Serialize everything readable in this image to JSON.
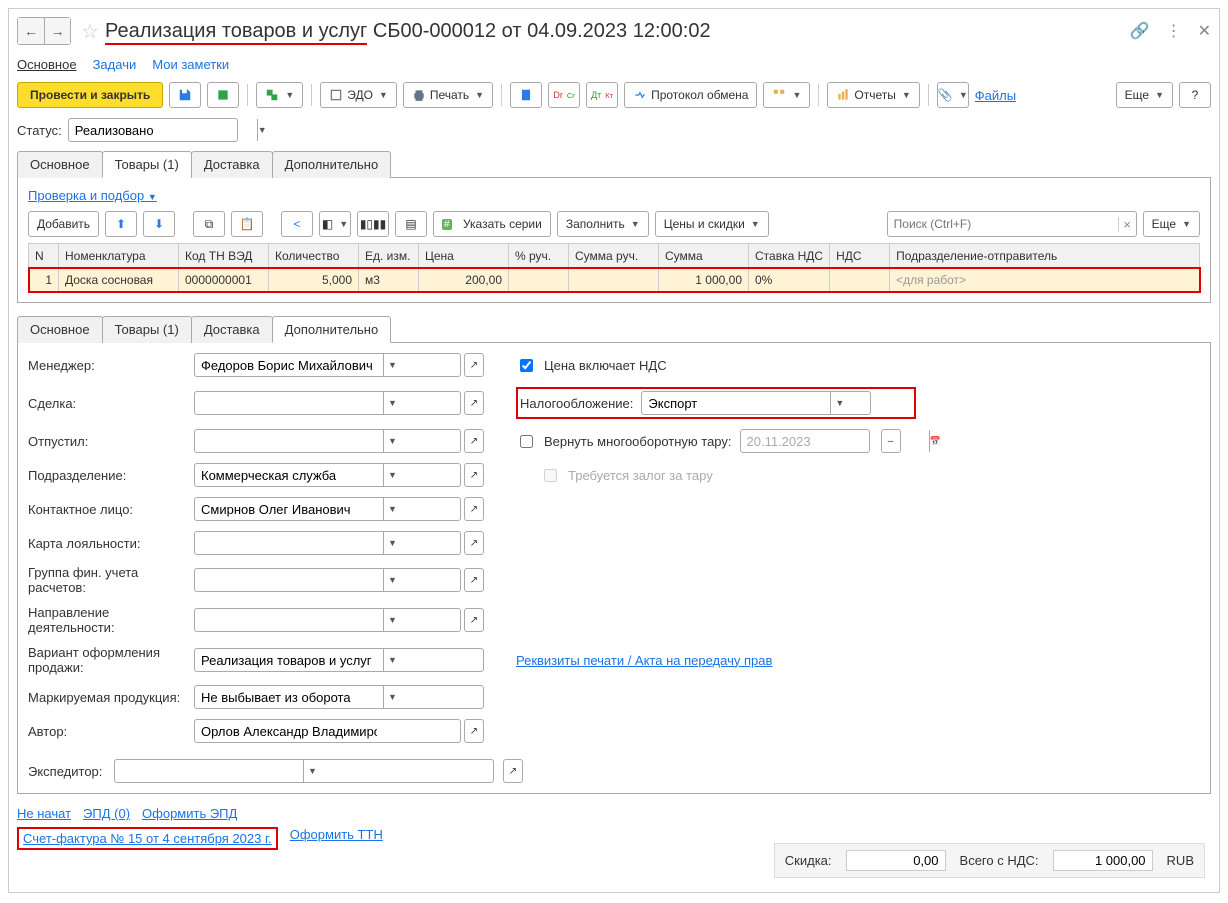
{
  "title": {
    "underlined": "Реализация товаров и услуг",
    "rest": " СБ00-000012 от 04.09.2023 12:00:02"
  },
  "topnav": {
    "main": "Основное",
    "tasks": "Задачи",
    "notes": "Мои заметки"
  },
  "toolbar": {
    "post_close": "Провести и закрыть",
    "edo": "ЭДО",
    "print": "Печать",
    "protocol": "Протокол обмена",
    "reports": "Отчеты",
    "files": "Файлы",
    "more": "Еще",
    "help": "?"
  },
  "status": {
    "label": "Статус:",
    "value": "Реализовано"
  },
  "tabs1": [
    "Основное",
    "Товары (1)",
    "Доставка",
    "Дополнительно"
  ],
  "goods": {
    "check_select": "Проверка и подбор",
    "add": "Добавить",
    "series": "Указать серии",
    "fill": "Заполнить",
    "prices": "Цены и скидки",
    "search_ph": "Поиск (Ctrl+F)",
    "more": "Еще",
    "headers": [
      "N",
      "Номенклатура",
      "Код ТН ВЭД",
      "Количество",
      "Ед. изм.",
      "Цена",
      "% руч.",
      "Сумма руч.",
      "Сумма",
      "Ставка НДС",
      "НДС",
      "Подразделение-отправитель"
    ],
    "row": {
      "n": "1",
      "item": "Доска сосновая",
      "code": "0000000001",
      "qty": "5,000",
      "unit": "м3",
      "price": "200,00",
      "pct": "",
      "sum_m": "",
      "sum": "1 000,00",
      "vat": "0%",
      "vat_amt": "",
      "dept_ph": "<для работ>"
    }
  },
  "tabs2": [
    "Основное",
    "Товары (1)",
    "Доставка",
    "Дополнительно"
  ],
  "details": {
    "manager_l": "Менеджер:",
    "manager_v": "Федоров Борис Михайлович",
    "price_incl_vat": "Цена включает НДС",
    "deal_l": "Сделка:",
    "tax_l": "Налогообложение:",
    "tax_v": "Экспорт",
    "released_l": "Отпустил:",
    "return_tare": "Вернуть многооборотную тару:",
    "return_date": "20.11.2023",
    "dept_l": "Подразделение:",
    "dept_v": "Коммерческая служба",
    "deposit": "Требуется залог за тару",
    "contact_l": "Контактное лицо:",
    "contact_v": "Смирнов Олег Иванович",
    "loyalty_l": "Карта лояльности:",
    "fingroup_l": "Группа фин. учета расчетов:",
    "activity_l": "Направление деятельности:",
    "variant_l": "Вариант оформления продажи:",
    "variant_v": "Реализация товаров и услуг",
    "requisites": "Реквизиты печати / Акта на передачу прав",
    "mark_l": "Маркируемая продукция:",
    "mark_v": "Не выбывает из оборота",
    "author_l": "Автор:",
    "author_v": "Орлов Александр Владимирович",
    "expeditor_l": "Экспедитор:"
  },
  "footer": {
    "not_started": "Не начат",
    "epd": "ЭПД (0)",
    "make_epd": "Оформить ЭПД",
    "invoice": "Счет-фактура № 15 от 4 сентября 2023 г.",
    "make_ttn": "Оформить ТТН",
    "discount_l": "Скидка:",
    "discount_v": "0,00",
    "total_l": "Всего с НДС:",
    "total_v": "1 000,00",
    "cur": "RUB"
  }
}
